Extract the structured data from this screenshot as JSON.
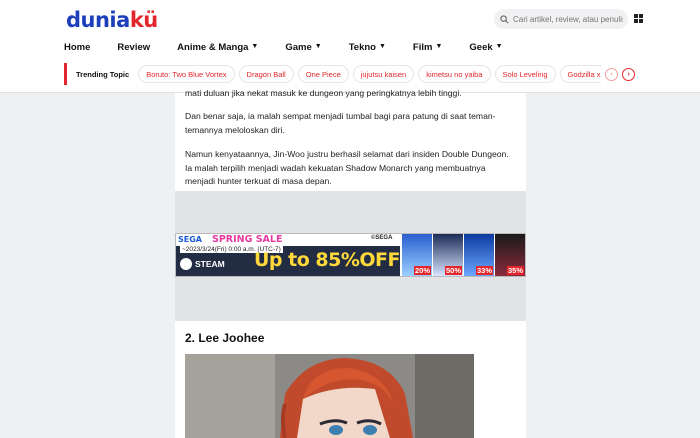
{
  "header": {
    "logo_part1": "dunia",
    "logo_part2": "kü",
    "search_placeholder": "Cari artikel, review, atau penulis"
  },
  "nav": {
    "items": [
      {
        "label": "Home",
        "has_dropdown": false
      },
      {
        "label": "Review",
        "has_dropdown": false
      },
      {
        "label": "Anime & Manga",
        "has_dropdown": true
      },
      {
        "label": "Game",
        "has_dropdown": true
      },
      {
        "label": "Tekno",
        "has_dropdown": true
      },
      {
        "label": "Film",
        "has_dropdown": true
      },
      {
        "label": "Geek",
        "has_dropdown": true
      }
    ]
  },
  "trending": {
    "title": "Trending Topic",
    "topics": [
      "Boruto: Two Blue Vortex",
      "Dragon Ball",
      "One Piece",
      "jujutsu kaisen",
      "kimetsu no yaiba",
      "Solo Leveling",
      "Godzilla x Kong"
    ]
  },
  "article": {
    "para1": "mati duluan jika nekat masuk ke dungeon yang peringkatnya lebih tinggi.",
    "para2": "Dan benar saja, ia malah sempat menjadi tumbal bagi para patung di saat teman-temannya meloloskan diri.",
    "para3": "Namun kenyataannya, Jin-Woo justru berhasil selamat dari insiden Double Dungeon. Ia malah terpilih menjadi wadah kekuatan Shadow Monarch yang membuatnya menjadi hunter terkuat di masa depan.",
    "section_title": "2. Lee Joohee"
  },
  "ad": {
    "brand": "SEGA",
    "headline": "SPRING SALE",
    "date": "~2023/3/24(Fri) 0:00 a.m. (UTC-7)",
    "brand_right": "©SEGA",
    "platform": "STEAM",
    "offer": "Up to 85%OFF!",
    "discounts": [
      "20%",
      "50%",
      "33%",
      "35%"
    ]
  },
  "colors": {
    "accent": "#e3262b",
    "logo_blue": "#1d3fbb"
  }
}
